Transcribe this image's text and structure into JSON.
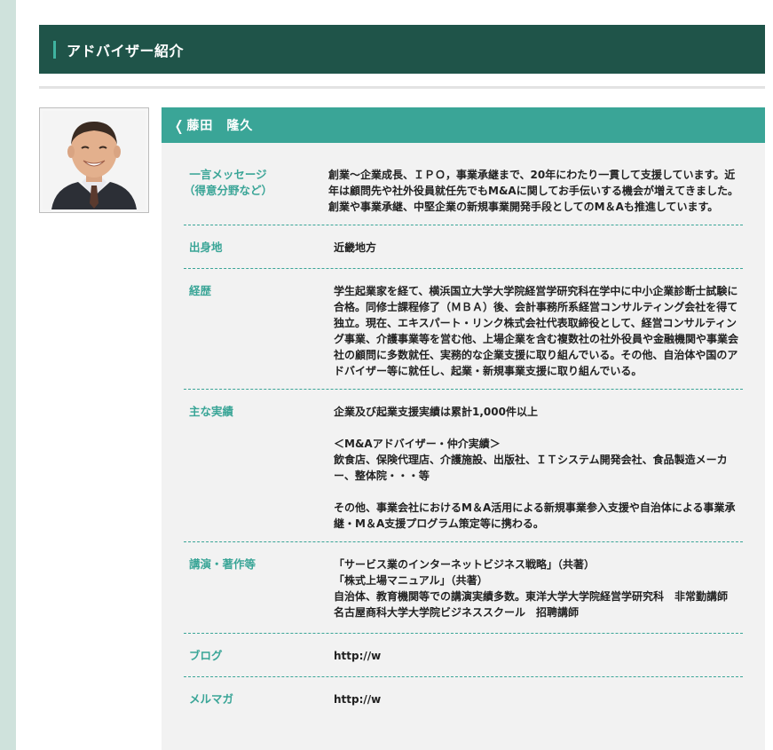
{
  "section": {
    "title": "アドバイザー紹介"
  },
  "advisor": {
    "back_icon": "chevron-left-icon",
    "name": "藤田　隆久",
    "photo_alt": "advisor-portrait"
  },
  "profile": {
    "message_label": "一言メッセージ\n（得意分野など）",
    "message": "創業～企業成長、ＩＰＯ，事業承継まで、20年にわたり一貫して支援しています。近年は顧問先や社外役員就任先でもM&Aに関してお手伝いする機会が増えてきました。創業や事業承継、中堅企業の新規事業開発手段としてのM＆Aも推進しています。",
    "origin_label": "出身地",
    "origin": "近畿地方",
    "career_label": "経歴",
    "career": "学生起業家を経て、横浜国立大学大学院経営学研究科在学中に中小企業診断士試験に合格。同修士課程修了（ＭＢＡ）後、会計事務所系経営コンサルティング会社を得て独立。現在、エキスパート・リンク株式会社代表取締役として、経営コンサルティング事業、介護事業等を営む他、上場企業を含む複数社の社外役員や金融機関や事業会社の顧問に多数就任、実務的な企業支援に取り組んでいる。その他、自治体や国のアドバイザー等に就任し、起業・新規事業支援に取り組んでいる。",
    "achievements_label": "主な実績",
    "achievements": "企業及び起業支援実績は累計1,000件以上\n\n＜M&Aアドバイザー・仲介実績＞\n飲食店、保険代理店、介護施設、出版社、ＩＴシステム開発会社、食品製造メーカー、整体院・・・等\n\nその他、事業会社におけるM＆A活用による新規事業参入支援や自治体による事業承継・M＆A支援プログラム策定等に携わる。",
    "publications_label": "講演・著作等",
    "publications": "「サービス業のインターネットビジネス戦略」（共著）\n「株式上場マニュアル」（共著）\n自治体、教育機関等での講演実績多数。東洋大学大学院経営学研究科　非常勤講師\n名古屋商科大学大学院ビジネススクール　招聘講師",
    "blog_label": "ブログ",
    "blog": "http://w",
    "mailmag_label": "メルマガ",
    "mailmag": "http://w"
  },
  "colors": {
    "header_bg": "#1f5449",
    "accent": "#3aa597",
    "panel_bg": "#f2f2f2"
  }
}
